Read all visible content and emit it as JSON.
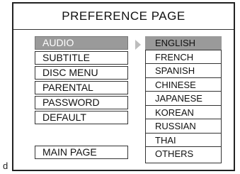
{
  "window": {
    "title": "PREFERENCE PAGE"
  },
  "menu": {
    "items": [
      {
        "label": "AUDIO",
        "selected": true
      },
      {
        "label": "SUBTITLE",
        "selected": false
      },
      {
        "label": "DISC MENU",
        "selected": false
      },
      {
        "label": "PARENTAL",
        "selected": false
      },
      {
        "label": "PASSWORD",
        "selected": false
      },
      {
        "label": "DEFAULT",
        "selected": false
      }
    ],
    "main_page_label": "MAIN PAGE"
  },
  "options": {
    "items": [
      {
        "label": "ENGLISH",
        "selected": true
      },
      {
        "label": "FRENCH",
        "selected": false
      },
      {
        "label": "SPANISH",
        "selected": false
      },
      {
        "label": "CHINESE",
        "selected": false
      },
      {
        "label": "JAPANESE",
        "selected": false
      },
      {
        "label": "KOREAN",
        "selected": false
      },
      {
        "label": "RUSSIAN",
        "selected": false
      },
      {
        "label": "THAI",
        "selected": false
      },
      {
        "label": "OTHERS",
        "selected": false
      }
    ]
  },
  "margin_text": "d",
  "colors": {
    "selected_bg": "#9a9a9a",
    "selected_text": "#ffffff",
    "arrow": "#bdbdbd",
    "border": "#333333"
  }
}
